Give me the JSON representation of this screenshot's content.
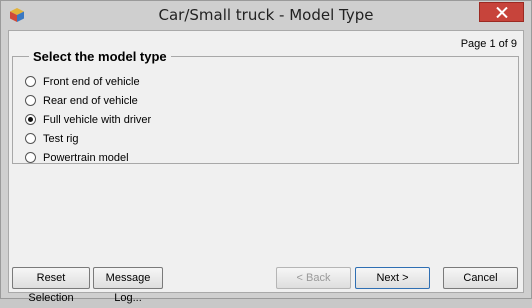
{
  "window": {
    "title": "Car/Small truck - Model Type"
  },
  "page_indicator": "Page  1 of 9",
  "group": {
    "title": "Select the model type",
    "options": [
      {
        "label": "Front end of vehicle",
        "checked": false
      },
      {
        "label": "Rear end of vehicle",
        "checked": false
      },
      {
        "label": "Full vehicle with driver",
        "checked": true
      },
      {
        "label": "Test rig",
        "checked": false
      },
      {
        "label": "Powertrain model",
        "checked": false
      }
    ]
  },
  "buttons": {
    "reset": "Reset Selection",
    "message_log": "Message Log...",
    "back": "< Back",
    "next": "Next >",
    "cancel": "Cancel"
  },
  "colors": {
    "close_button": "#c7443b",
    "client_background": "#f0f0f0"
  }
}
